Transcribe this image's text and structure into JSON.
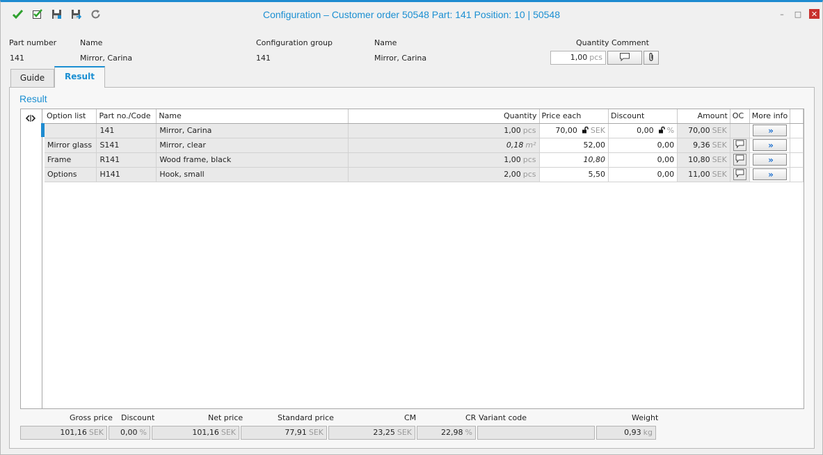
{
  "window": {
    "title": "Configuration – Customer order 50548 Part: 141 Position: 10 | 50548",
    "toolbar_icons": [
      "ok-check-icon",
      "checkbox-check-icon",
      "save-icon",
      "save-close-icon",
      "refresh-icon"
    ],
    "close_glyph": "✕",
    "minimize_glyph": "–",
    "maximize_glyph": "□"
  },
  "header": {
    "labels": {
      "part_number": "Part number",
      "name": "Name",
      "config_group": "Configuration group",
      "name2": "Name",
      "quantity_comment": "Quantity Comment"
    },
    "values": {
      "part_number": "141",
      "name": "Mirror, Carina",
      "config_group": "141",
      "name2": "Mirror, Carina",
      "quantity": "1,00",
      "quantity_unit": "pcs"
    }
  },
  "tabs": [
    {
      "label": "Guide"
    },
    {
      "label": "Result"
    }
  ],
  "section_title": "Result",
  "grid": {
    "columns": [
      "Option list",
      "Part no./Code",
      "Name",
      "",
      "Quantity",
      "Price each",
      "Discount",
      "Amount",
      "OC",
      "More info"
    ],
    "rows": [
      {
        "option_list": "",
        "part_no": "141",
        "name": "Mirror, Carina",
        "quantity": "1,00",
        "qty_unit": "pcs",
        "price": "70,00",
        "price_unit": "SEK",
        "discount": "0,00",
        "discount_unit": "%",
        "amount": "70,00",
        "amount_unit": "SEK"
      },
      {
        "option_list": "Mirror glass",
        "part_no": "S141",
        "name": "Mirror, clear",
        "quantity": "0,18",
        "qty_unit": "m²",
        "price": "52,00",
        "price_unit": "",
        "discount": "0,00",
        "discount_unit": "",
        "amount": "9,36",
        "amount_unit": "SEK"
      },
      {
        "option_list": "Frame",
        "part_no": "R141",
        "name": "Wood frame, black",
        "quantity": "1,00",
        "qty_unit": "pcs",
        "price": "10,80",
        "price_unit": "",
        "discount": "0,00",
        "discount_unit": "",
        "amount": "10,80",
        "amount_unit": "SEK"
      },
      {
        "option_list": "Options",
        "part_no": "H141",
        "name": "Hook, small",
        "quantity": "2,00",
        "qty_unit": "pcs",
        "price": "5,50",
        "price_unit": "",
        "discount": "0,00",
        "discount_unit": "",
        "amount": "11,00",
        "amount_unit": "SEK"
      }
    ],
    "more_glyph": "»"
  },
  "footer": {
    "gross_price": {
      "label": "Gross price",
      "value": "101,16",
      "unit": "SEK"
    },
    "discount": {
      "label": "Discount",
      "value": "0,00",
      "unit": "%"
    },
    "net_price": {
      "label": "Net price",
      "value": "101,16",
      "unit": "SEK"
    },
    "standard_price": {
      "label": "Standard price",
      "value": "77,91",
      "unit": "SEK"
    },
    "cm": {
      "label": "CM",
      "value": "23,25",
      "unit": "SEK"
    },
    "cr": {
      "label": "CR",
      "value": "22,98",
      "unit": "%"
    },
    "variant_code": {
      "label": "Variant code",
      "value": ""
    },
    "weight": {
      "label": "Weight",
      "value": "0,93",
      "unit": "kg"
    }
  },
  "colors": {
    "accent": "#1b8fd2",
    "close_button": "#c8302d",
    "check_green": "#2fa12f"
  }
}
